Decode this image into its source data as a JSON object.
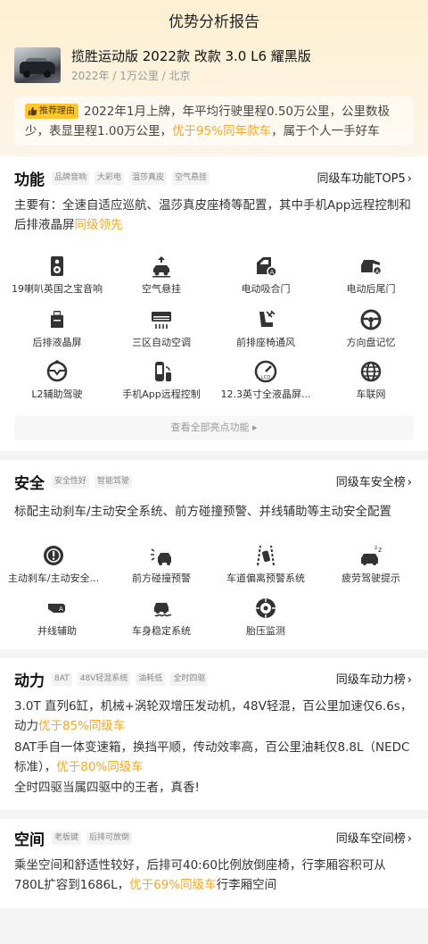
{
  "header": {
    "title": "优势分析报告"
  },
  "car": {
    "name": "揽胜运动版 2022款 改款 3.0 L6 耀黑版",
    "meta": "2022年 / 1万公里 / 北京"
  },
  "recommend": {
    "tag": "推荐理由",
    "text_a": "2022年1月上牌，年平均行驶里程0.50万公里，公里数极少，表显里程1.00万公里，",
    "text_hl": "优于95%同年款车",
    "text_b": "，属于个人一手好车"
  },
  "function": {
    "title": "功能",
    "tags": [
      "品牌音响",
      "大彩电",
      "温莎真皮",
      "空气悬挂"
    ],
    "rank_link": "同级车功能TOP5",
    "desc_a": "主要有：全速自适应巡航、温莎真皮座椅等配置，其中手机App远程控制和后排液晶屏",
    "desc_hl": "同级领先",
    "features": [
      {
        "label": "19喇叭英国之宝音响",
        "icon": "speaker-icon"
      },
      {
        "label": "空气悬挂",
        "icon": "air-suspension-icon"
      },
      {
        "label": "电动吸合门",
        "icon": "soft-close-door-icon"
      },
      {
        "label": "电动后尾门",
        "icon": "power-tailgate-icon"
      },
      {
        "label": "后排液晶屏",
        "icon": "rear-screen-icon"
      },
      {
        "label": "三区自动空调",
        "icon": "climate-control-icon"
      },
      {
        "label": "前排座椅通风",
        "icon": "seat-ventilation-icon"
      },
      {
        "label": "方向盘记忆",
        "icon": "steering-memory-icon"
      },
      {
        "label": "L2辅助驾驶",
        "icon": "assisted-driving-icon"
      },
      {
        "label": "手机App远程控制",
        "icon": "remote-app-icon"
      },
      {
        "label": "12.3英寸全液晶屏...",
        "icon": "lcd-dashboard-icon"
      },
      {
        "label": "车联网",
        "icon": "connected-car-icon"
      }
    ],
    "view_all": "查看全部亮点功能"
  },
  "safety": {
    "title": "安全",
    "tags": [
      "安全性好",
      "智能驾驶"
    ],
    "rank_link": "同级车安全榜",
    "desc": "标配主动刹车/主动安全系统、前方碰撞预警、并线辅助等主动安全配置",
    "features": [
      {
        "label": "主动刹车/主动安全...",
        "icon": "active-brake-icon"
      },
      {
        "label": "前方碰撞预警",
        "icon": "collision-warning-icon"
      },
      {
        "label": "车道偏离预警系统",
        "icon": "lane-departure-icon"
      },
      {
        "label": "疲劳驾驶提示",
        "icon": "fatigue-alert-icon"
      },
      {
        "label": "并线辅助",
        "icon": "blind-spot-icon"
      },
      {
        "label": "车身稳定系统",
        "icon": "stability-control-icon"
      },
      {
        "label": "胎压监测",
        "icon": "tire-pressure-icon"
      }
    ]
  },
  "power": {
    "title": "动力",
    "tags": [
      "8AT",
      "48V轻混系统",
      "油耗低",
      "全时四驱"
    ],
    "rank_link": "同级车动力榜",
    "p1_a": "3.0T 直列6缸，机械+涡轮双增压发动机，48V轻混，百公里加速仅6.6s，动力",
    "p1_hl": "优于85%同级车",
    "p2_a": "8AT手自一体变速箱，换挡平顺，传动效率高，百公里油耗仅8.8L（NEDC标准），",
    "p2_hl": "优于80%同级车",
    "p3": "全时四驱当属四驱中的王者，真香!"
  },
  "space": {
    "title": "空间",
    "tags": [
      "老板键",
      "后排可放倒"
    ],
    "rank_link": "同级车空间榜",
    "desc_a": "乘坐空间和舒适性较好，后排可40:60比例放倒座椅，行李厢容积可从780L扩容到1686L，",
    "desc_hl": "优于69%同级车",
    "desc_b": "行李厢空间"
  },
  "colors": {
    "accent": "#f5a623",
    "tag_bg": "#ffc72c"
  }
}
